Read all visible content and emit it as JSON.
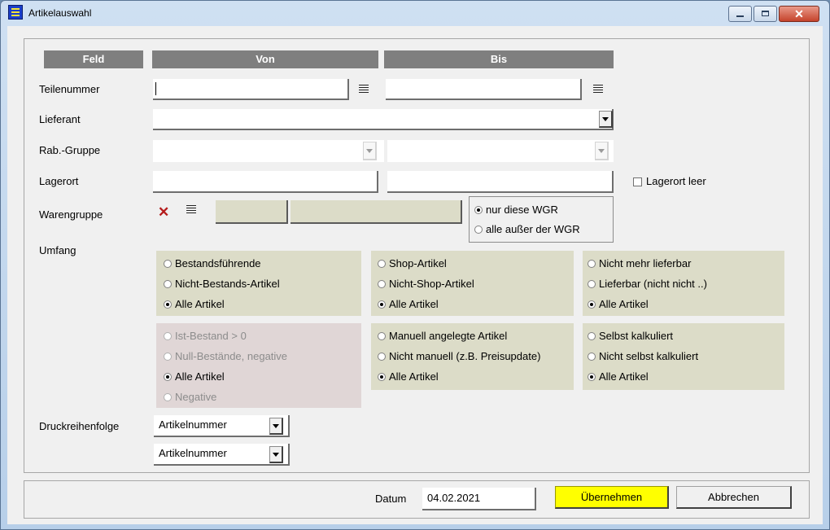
{
  "window": {
    "title": "Artikelauswahl",
    "title_icon": "lines-icon",
    "controls": [
      "minimize-icon",
      "maximize-icon",
      "close-icon"
    ]
  },
  "headers": {
    "feld": "Feld",
    "von": "Von",
    "bis": "Bis"
  },
  "fields": {
    "teilenummer": {
      "label": "Teilenummer",
      "von": "",
      "bis": ""
    },
    "lieferant": {
      "label": "Lieferant",
      "value": ""
    },
    "rab_gruppe": {
      "label": "Rab.-Gruppe",
      "von": "",
      "bis": ""
    },
    "lagerort": {
      "label": "Lagerort",
      "von": "",
      "bis": "",
      "leer_label": "Lagerort leer",
      "leer_checked": false
    },
    "warengruppe": {
      "label": "Warengruppe",
      "von": "",
      "bis": "",
      "options": [
        "nur diese WGR",
        "alle außer der WGR"
      ],
      "selected": 0
    }
  },
  "umfang": {
    "label": "Umfang",
    "groups": [
      {
        "options": [
          "Bestandsführende",
          "Nicht-Bestands-Artikel",
          "Alle Artikel"
        ],
        "selected": 2
      },
      {
        "options": [
          "Shop-Artikel",
          "Nicht-Shop-Artikel",
          "Alle Artikel"
        ],
        "selected": 2
      },
      {
        "options": [
          "Nicht mehr lieferbar",
          "Lieferbar (nicht nicht ..)",
          "Alle Artikel"
        ],
        "selected": 2
      },
      {
        "options": [
          "Ist-Bestand > 0",
          "Null-Bestände, negative",
          "Alle Artikel",
          "Negative"
        ],
        "selected": 2,
        "disabled": [
          0,
          1,
          3
        ]
      },
      {
        "options": [
          "Manuell angelegte Artikel",
          "Nicht manuell (z.B. Preisupdate)",
          "Alle Artikel"
        ],
        "selected": 2
      },
      {
        "options": [
          "Selbst kalkuliert",
          "Nicht selbst kalkuliert",
          "Alle Artikel"
        ],
        "selected": 2
      }
    ]
  },
  "druckreihenfolge": {
    "label": "Druckreihenfolge",
    "first": "Artikelnummer",
    "second": "Artikelnummer"
  },
  "footer": {
    "datum_label": "Datum",
    "datum_value": "04.02.2021",
    "ok_label": "Übernehmen",
    "cancel_label": "Abbrechen"
  },
  "colors": {
    "ok_button": "#ffff00",
    "header_bg": "#7f7f7f",
    "panel_bg": "#dcdcc8",
    "panel_disabled_bg": "#e0d6d6",
    "delete_icon": "#b51b1b"
  }
}
